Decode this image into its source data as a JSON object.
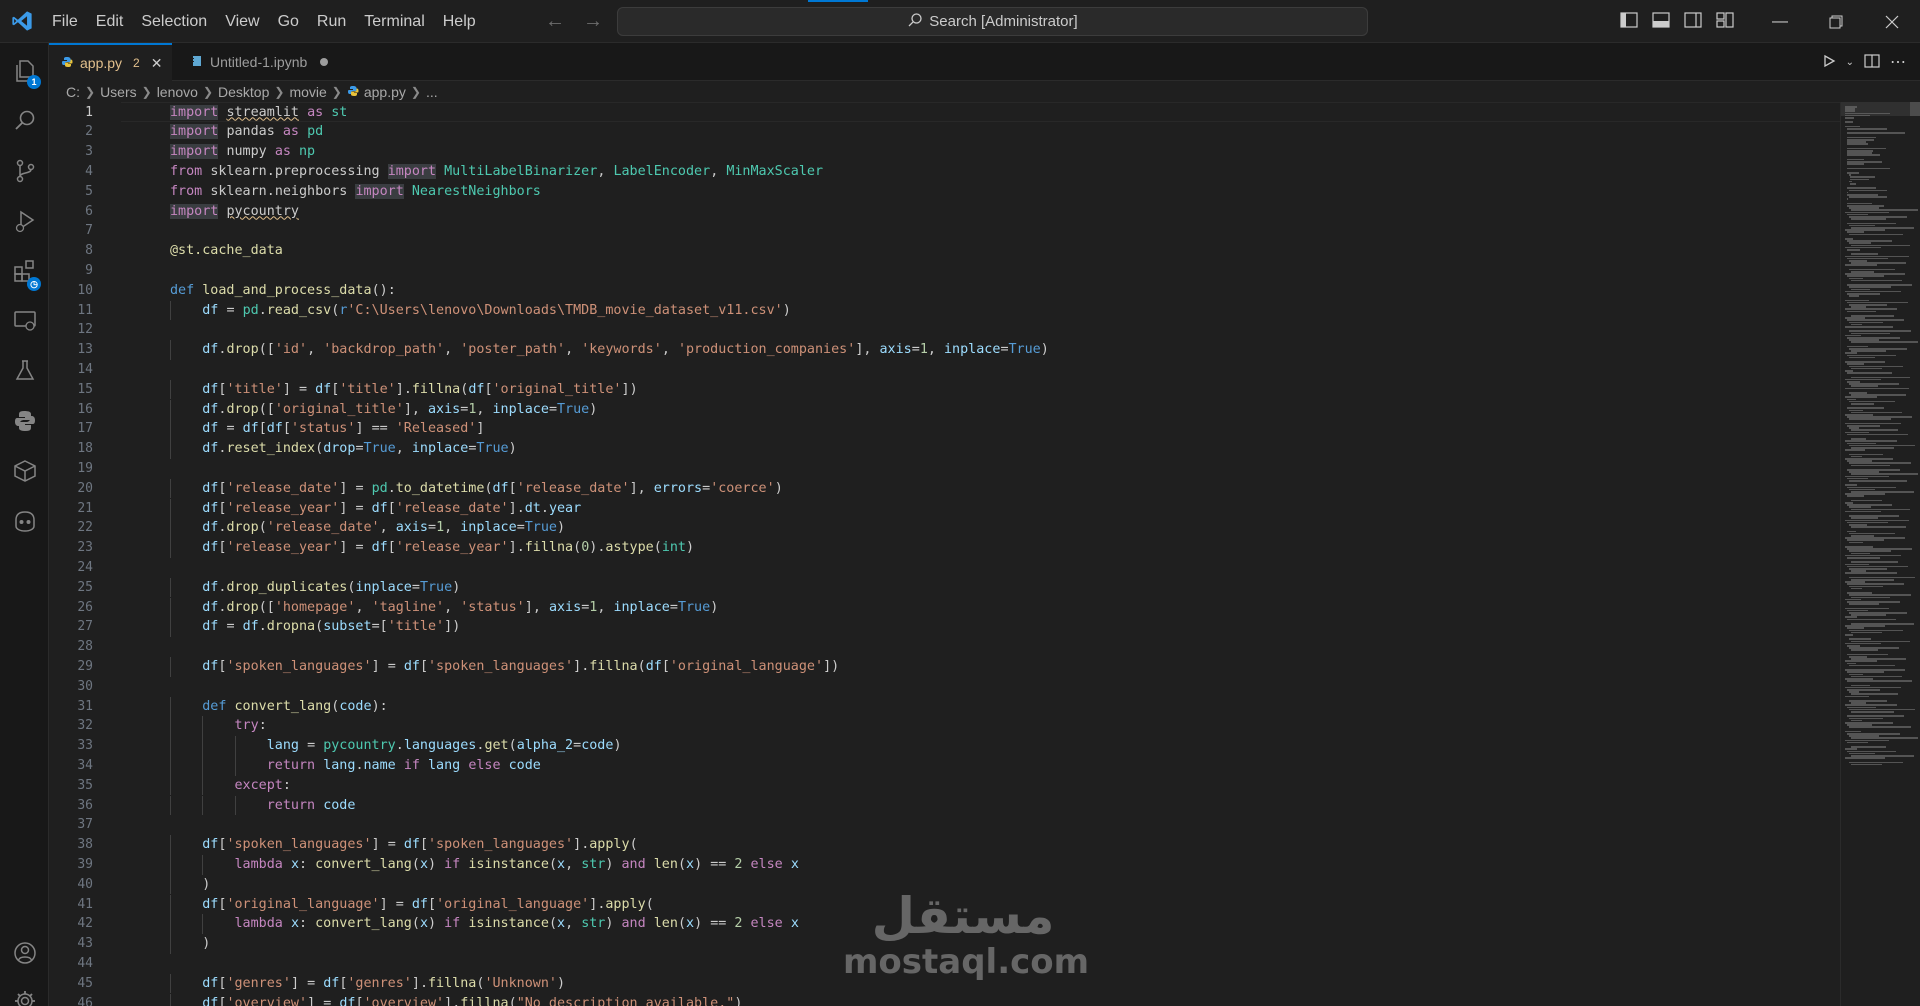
{
  "menu": [
    "File",
    "Edit",
    "Selection",
    "View",
    "Go",
    "Run",
    "Terminal",
    "Help"
  ],
  "search": {
    "label": "Search [Administrator]"
  },
  "activity_bar": {
    "explorer_badge": "1"
  },
  "tabs": [
    {
      "label": "app.py",
      "count": "2",
      "active": true
    },
    {
      "label": "Untitled-1.ipynb",
      "active": false
    }
  ],
  "breadcrumb": [
    "C:",
    "Users",
    "lenovo",
    "Desktop",
    "movie",
    "app.py",
    "..."
  ],
  "line_numbers": [
    "1",
    "2",
    "3",
    "4",
    "5",
    "6",
    "7",
    "8",
    "9",
    "10",
    "11",
    "12",
    "13",
    "14",
    "15",
    "16",
    "17",
    "18",
    "19",
    "20",
    "21",
    "22",
    "23",
    "24",
    "25",
    "26",
    "27",
    "28",
    "29",
    "30",
    "31",
    "32",
    "33",
    "34",
    "35",
    "36",
    "37",
    "38",
    "39",
    "40",
    "41",
    "42",
    "43",
    "44",
    "45",
    "46"
  ],
  "current_line": "1",
  "code_lines": [
    "import streamlit as st",
    "import pandas as pd",
    "import numpy as np",
    "from sklearn.preprocessing import MultiLabelBinarizer, LabelEncoder, MinMaxScaler",
    "from sklearn.neighbors import NearestNeighbors",
    "import pycountry",
    "",
    "@st.cache_data",
    "",
    "def load_and_process_data():",
    "    df = pd.read_csv(r'C:\\Users\\lenovo\\Downloads\\TMDB_movie_dataset_v11.csv')",
    "",
    "    df.drop(['id', 'backdrop_path', 'poster_path', 'keywords', 'production_companies'], axis=1, inplace=True)",
    "",
    "    df['title'] = df['title'].fillna(df['original_title'])",
    "    df.drop(['original_title'], axis=1, inplace=True)",
    "    df = df[df['status'] == 'Released']",
    "    df.reset_index(drop=True, inplace=True)",
    "",
    "    df['release_date'] = pd.to_datetime(df['release_date'], errors='coerce')",
    "    df['release_year'] = df['release_date'].dt.year",
    "    df.drop('release_date', axis=1, inplace=True)",
    "    df['release_year'] = df['release_year'].fillna(0).astype(int)",
    "",
    "    df.drop_duplicates(inplace=True)",
    "    df.drop(['homepage', 'tagline', 'status'], axis=1, inplace=True)",
    "    df = df.dropna(subset=['title'])",
    "",
    "    df['spoken_languages'] = df['spoken_languages'].fillna(df['original_language'])",
    "",
    "    def convert_lang(code):",
    "        try:",
    "            lang = pycountry.languages.get(alpha_2=code)",
    "            return lang.name if lang else code",
    "        except:",
    "            return code",
    "",
    "    df['spoken_languages'] = df['spoken_languages'].apply(",
    "        lambda x: convert_lang(x) if isinstance(x, str) and len(x) == 2 else x",
    "    )",
    "    df['original_language'] = df['original_language'].apply(",
    "        lambda x: convert_lang(x) if isinstance(x, str) and len(x) == 2 else x",
    "    )",
    "",
    "    df['genres'] = df['genres'].fillna('Unknown')",
    "    df['overview'] = df['overview'].fillna(\"No description available.\")"
  ],
  "watermark": {
    "arabic": "مستقل",
    "latin": "mostaql.com"
  },
  "colors": {
    "accent": "#0078d4",
    "modified": "#e2c08d",
    "keyword": "#c586c0",
    "string": "#ce9178",
    "function": "#dcdcaa",
    "variable": "#9cdcfe",
    "class": "#4ec9b0",
    "number": "#b5cea8",
    "storage": "#569cd6"
  }
}
